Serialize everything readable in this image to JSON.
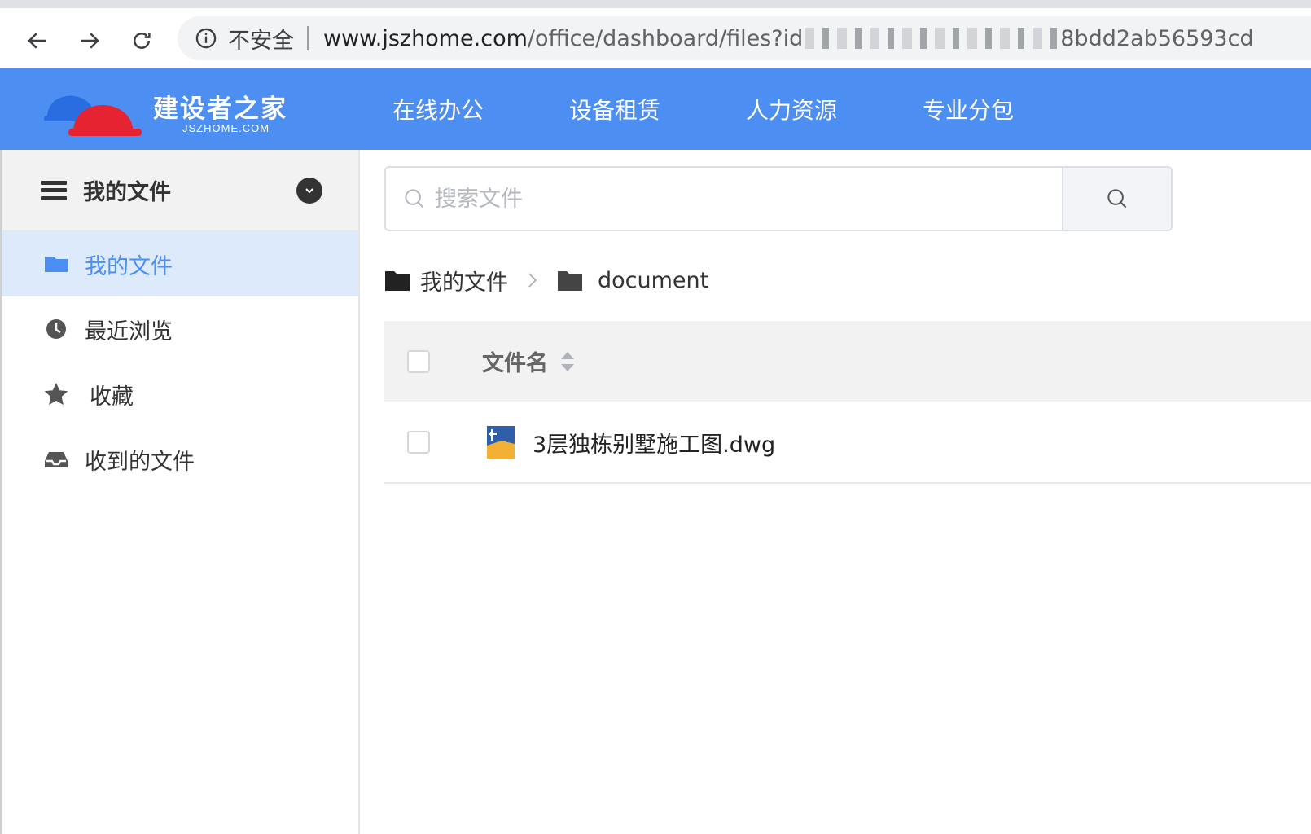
{
  "browser": {
    "security_label": "不安全",
    "url_host": "www.jszhome.com",
    "url_path": "/office/dashboard/files?id",
    "url_tail": "8bdd2ab56593cd"
  },
  "header": {
    "logo_title": "建设者之家",
    "logo_sub": "JSZHOME.COM",
    "nav": [
      "在线办公",
      "设备租赁",
      "人力资源",
      "专业分包"
    ]
  },
  "sidebar": {
    "title": "我的文件",
    "items": [
      {
        "label": "我的文件",
        "icon": "folder-icon",
        "active": true
      },
      {
        "label": "最近浏览",
        "icon": "clock-icon",
        "active": false
      },
      {
        "label": "收藏",
        "icon": "star-icon",
        "active": false
      },
      {
        "label": "收到的文件",
        "icon": "inbox-icon",
        "active": false
      }
    ]
  },
  "search": {
    "placeholder": "搜索文件",
    "value": ""
  },
  "breadcrumb": [
    "我的文件",
    "document"
  ],
  "table": {
    "header_name": "文件名",
    "rows": [
      {
        "name": "3层独栋别墅施工图.dwg",
        "icon": "dwg-file-icon"
      }
    ]
  },
  "colors": {
    "brand_blue": "#4d8ef3",
    "active_bg": "#ddeafc",
    "helmet_blue": "#2a6de0",
    "helmet_red": "#e62330"
  }
}
